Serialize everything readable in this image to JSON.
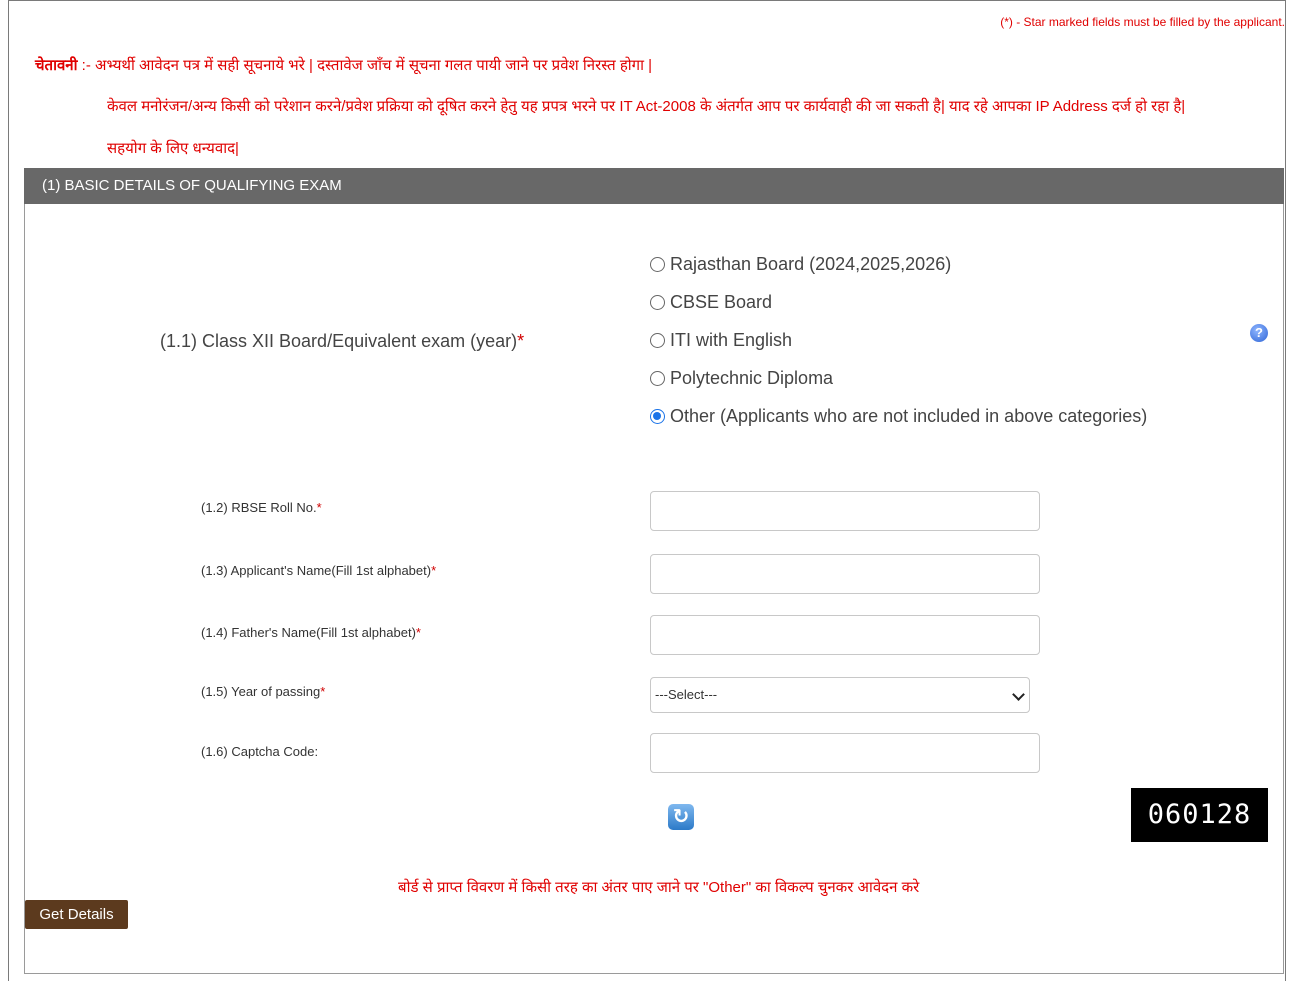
{
  "star_note": "(*) - Star marked fields must be filled by the applicant.",
  "warning": {
    "label": "चेतावनी",
    "line1": " :- अभ्यर्थी आवेदन पत्र में सही सूचनाये भरे | दस्तावेज जाँच में सूचना गलत पायी जाने पर प्रवेश निरस्त होगा |",
    "line2": "केवल मनोरंजन/अन्य किसी को परेशान करने/प्रवेश प्रक्रिया को दूषित करने हेतु यह प्रपत्र भरने पर IT Act-2008 के अंतर्गत आप पर कार्यवाही की जा सकती है| याद रहे आपका IP Address दर्ज हो रहा है|",
    "line3": "सहयोग के लिए धन्यवाद|"
  },
  "section": {
    "title": "(1) BASIC DETAILS OF QUALIFYING EXAM"
  },
  "q11": {
    "label": "(1.1) Class XII Board/Equivalent exam (year)",
    "required": "*",
    "options": [
      {
        "label": "Rajasthan Board (2024,2025,2026)",
        "selected": false
      },
      {
        "label": "CBSE Board",
        "selected": false
      },
      {
        "label": "ITI with English",
        "selected": false
      },
      {
        "label": "Polytechnic Diploma",
        "selected": false
      },
      {
        "label": "Other (Applicants who are not included in above categories)",
        "selected": true
      }
    ],
    "help_icon": "?"
  },
  "fields": {
    "roll_label": "(1.2) RBSE Roll No.",
    "name_label": "(1.3)  Applicant's Name(Fill 1st alphabet)",
    "father_label": "(1.4)  Father's Name(Fill 1st alphabet)",
    "year_label": "(1.5)  Year of passing",
    "captcha_label": "(1.6)  Captcha Code:",
    "required": "*",
    "year_select": "---Select---"
  },
  "captcha": {
    "code": "060128",
    "refresh_icon": "refresh-icon"
  },
  "note": "बोर्ड से प्राप्त विवरण में किसी तरह का अंतर पाए जाने पर \"Other\" का विकल्प चुनकर आवेदन करे",
  "get_details_button": "Get Details"
}
